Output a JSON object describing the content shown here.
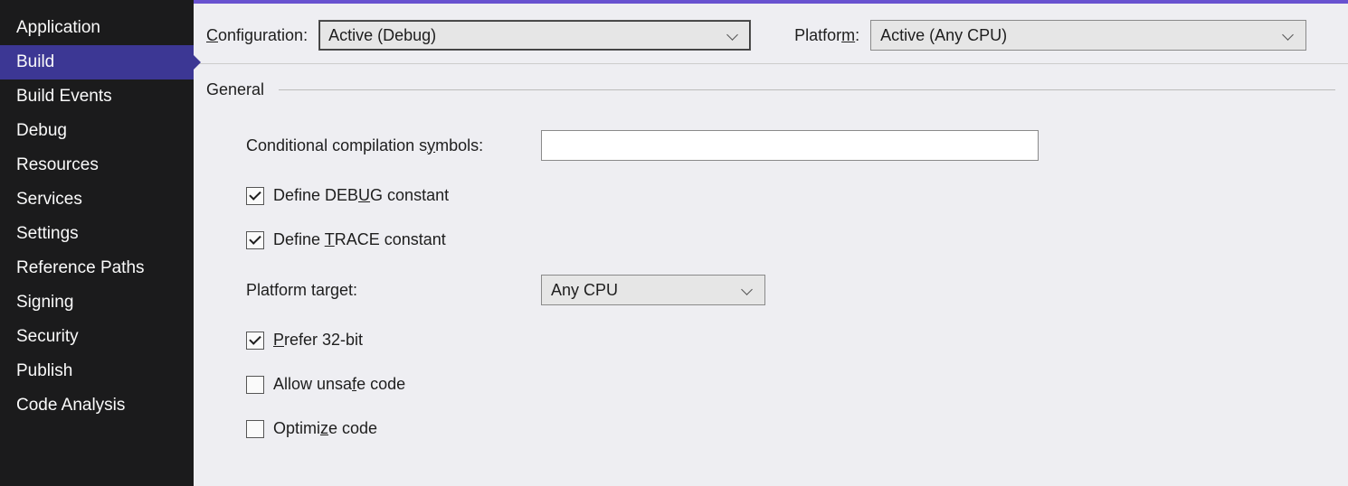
{
  "sidebar": {
    "items": [
      {
        "label": "Application"
      },
      {
        "label": "Build",
        "active": true
      },
      {
        "label": "Build Events"
      },
      {
        "label": "Debug"
      },
      {
        "label": "Resources"
      },
      {
        "label": "Services"
      },
      {
        "label": "Settings"
      },
      {
        "label": "Reference Paths"
      },
      {
        "label": "Signing"
      },
      {
        "label": "Security"
      },
      {
        "label": "Publish"
      },
      {
        "label": "Code Analysis"
      }
    ]
  },
  "toprow": {
    "configuration_label_pre": "C",
    "configuration_label_post": "onfiguration:",
    "configuration_value": "Active (Debug)",
    "platform_label_pre": "Platfor",
    "platform_label_u": "m",
    "platform_label_post": ":",
    "platform_value": "Active (Any CPU)"
  },
  "general": {
    "heading": "General",
    "symbols_label": "Conditional compilation s",
    "symbols_label_u": "y",
    "symbols_label_post": "mbols:",
    "symbols_value": "",
    "debug_pre": "Define DEB",
    "debug_u": "U",
    "debug_post": "G constant",
    "debug_checked": true,
    "trace_pre": "Define ",
    "trace_u": "T",
    "trace_post": "RACE constant",
    "trace_checked": true,
    "target_label_pre": "Platform tar",
    "target_label_u": "g",
    "target_label_post": "et:",
    "target_value": "Any CPU",
    "prefer_u": "P",
    "prefer_post": "refer 32-bit",
    "prefer_checked": true,
    "unsafe_pre": "Allow unsa",
    "unsafe_u": "f",
    "unsafe_post": "e code",
    "unsafe_checked": false,
    "optimize_pre": "Optimi",
    "optimize_u": "z",
    "optimize_post": "e code",
    "optimize_checked": false
  }
}
